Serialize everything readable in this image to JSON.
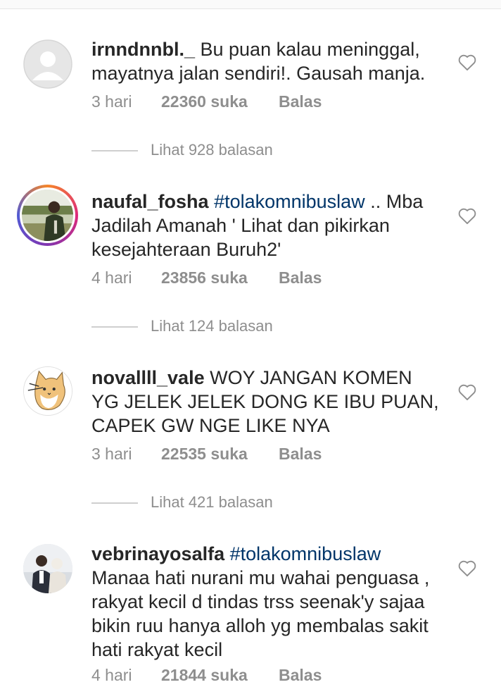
{
  "comments": [
    {
      "username": "irnndnnbl._",
      "hashtag": "",
      "text": "Bu puan kalau meninggal, mayatnya jalan sendiri!. Gausah manja.",
      "time": "3 hari",
      "likes": "22360 suka",
      "reply": "Balas",
      "view_replies": "Lihat 928 balasan",
      "avatar": "default-avatar-icon"
    },
    {
      "username": "naufal_fosha",
      "hashtag": "#tolakomnibuslaw",
      "text": ".. Mba Jadilah Amanah ' Lihat dan pikirkan kesejahteraan  Buruh2'",
      "time": "4 hari",
      "likes": "23856 suka",
      "reply": "Balas",
      "view_replies": "Lihat 124 balasan",
      "avatar": "person-photo"
    },
    {
      "username": "novallll_vale",
      "hashtag": "",
      "text": "WOY JANGAN KOMEN YG JELEK JELEK DONG KE IBU PUAN, CAPEK GW NGE LIKE NYA",
      "time": "3 hari",
      "likes": "22535 suka",
      "reply": "Balas",
      "view_replies": "Lihat 421 balasan",
      "avatar": "cat-drawing"
    },
    {
      "username": "vebrinayosalfa",
      "hashtag": "#tolakomnibuslaw",
      "text": "Manaa hati nurani mu wahai penguasa , rakyat kecil d tindas trss seenak'y sajaa bikin ruu hanya alloh yg membalas sakit hati rakyat kecil",
      "time": "4 hari",
      "likes": "21844 suka",
      "reply": "Balas",
      "view_replies": "",
      "avatar": "couple-photo"
    }
  ],
  "colors": {
    "text": "#262626",
    "meta": "#8e8e8e",
    "hashtag": "#003569"
  }
}
